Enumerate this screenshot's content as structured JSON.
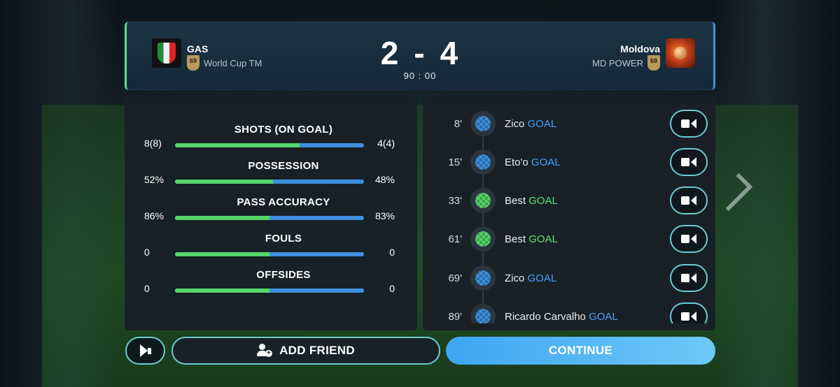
{
  "match": {
    "home": {
      "name": "GAS",
      "rating": "69",
      "sub": "World Cup TM"
    },
    "away": {
      "name": "Moldova",
      "rating": "68",
      "sub": "MD POWER"
    },
    "score_home": "2",
    "score_sep": "-",
    "score_away": "4",
    "time": "90 : 00"
  },
  "stats": [
    {
      "label": "SHOTS (ON GOAL)",
      "left": "8(8)",
      "right": "4(4)",
      "left_fraction": 0.66
    },
    {
      "label": "POSSESSION",
      "left": "52%",
      "right": "48%",
      "left_fraction": 0.52
    },
    {
      "label": "PASS ACCURACY",
      "left": "86%",
      "right": "83%",
      "left_fraction": 0.5
    },
    {
      "label": "FOULS",
      "left": "0",
      "right": "0",
      "left_fraction": 0.5
    },
    {
      "label": "OFFSIDES",
      "left": "0",
      "right": "0",
      "left_fraction": 0.5
    }
  ],
  "events": [
    {
      "minute": "8'",
      "player": "Zico",
      "type": "GOAL",
      "side": "away"
    },
    {
      "minute": "15'",
      "player": "Eto'o",
      "type": "GOAL",
      "side": "away"
    },
    {
      "minute": "33'",
      "player": "Best",
      "type": "GOAL",
      "side": "home"
    },
    {
      "minute": "61'",
      "player": "Best",
      "type": "GOAL",
      "side": "home"
    },
    {
      "minute": "69'",
      "player": "Zico",
      "type": "GOAL",
      "side": "away"
    },
    {
      "minute": "89'",
      "player": "Ricardo Carvalho",
      "type": "GOAL",
      "side": "away"
    }
  ],
  "buttons": {
    "add_friend": "ADD FRIEND",
    "continue": "CONTINUE"
  },
  "colors": {
    "home": "#56d66b",
    "away": "#3f8fe0",
    "accent": "#6ccbd0",
    "continue": "#4fb4f5"
  },
  "icons": {
    "replay": "video-camera-icon",
    "report": "megaphone-icon",
    "friend": "add-person-icon"
  }
}
